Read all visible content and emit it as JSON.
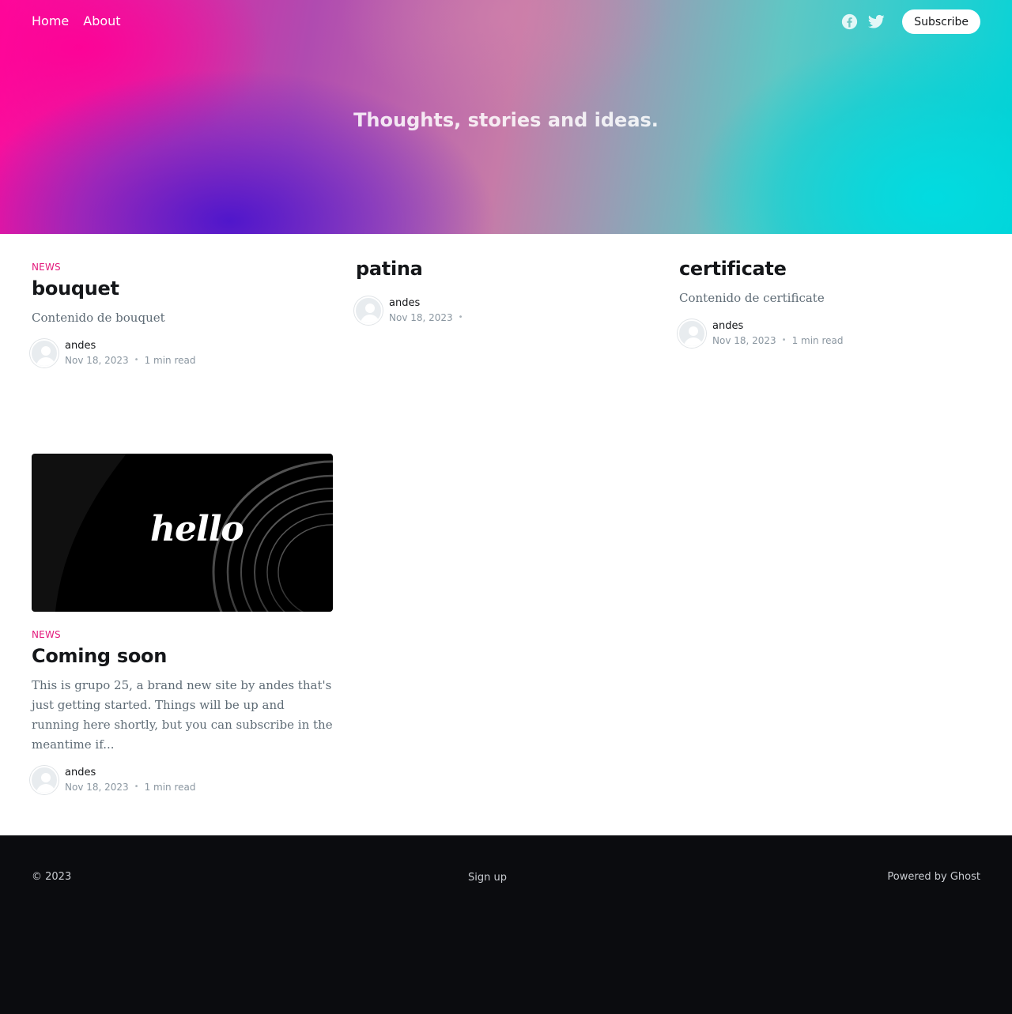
{
  "nav": {
    "items": [
      {
        "label": "Home"
      },
      {
        "label": "About"
      }
    ],
    "subscribe_label": "Subscribe"
  },
  "hero": {
    "tagline": "Thoughts, stories and ideas."
  },
  "posts": [
    {
      "tag": "News",
      "title": "bouquet",
      "excerpt": "Contenido de bouquet",
      "author": "andes",
      "date": "Nov 18, 2023",
      "read_time": "1 min read"
    },
    {
      "tag": "",
      "title": "patina",
      "excerpt": "",
      "author": "andes",
      "date": "Nov 18, 2023",
      "read_time": ""
    },
    {
      "tag": "",
      "title": "certificate",
      "excerpt": "Contenido de certificate",
      "author": "andes",
      "date": "Nov 18, 2023",
      "read_time": "1 min read"
    },
    {
      "tag": "News",
      "title": "Coming soon",
      "image_text": "hello",
      "excerpt": "This is grupo 25, a brand new site by andes that's just getting started. Things will be up and running here shortly, but you can subscribe in the meantime if...",
      "author": "andes",
      "date": "Nov 18, 2023",
      "read_time": "1 min read"
    }
  ],
  "footer": {
    "copyright": "© 2023",
    "signup_label": "Sign up",
    "powered_by": "Powered by Ghost"
  },
  "colors": {
    "accent": "#e3197c",
    "footer_bg": "#0b0c0f"
  },
  "icons": [
    "facebook-icon",
    "twitter-icon"
  ]
}
